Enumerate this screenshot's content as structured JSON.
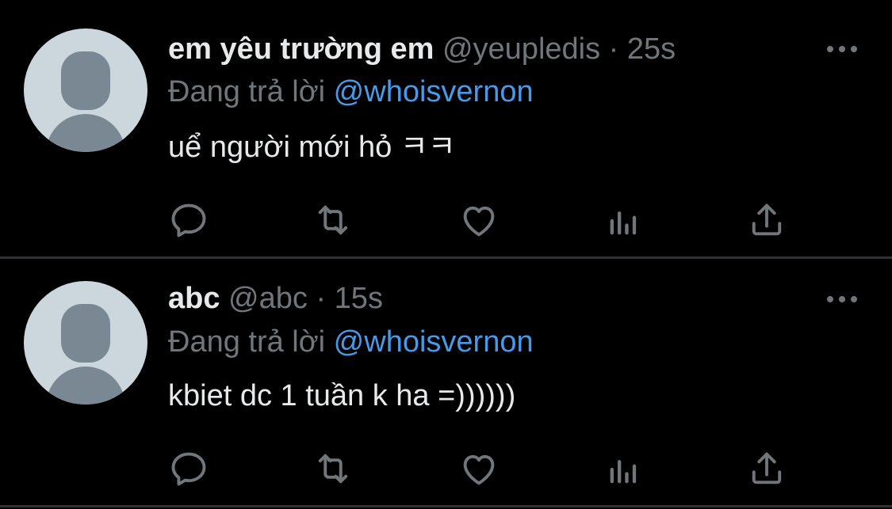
{
  "tweets": [
    {
      "name": "em yêu trường em",
      "handle": "@yeupledis",
      "separator": "·",
      "time": "25s",
      "reply_prefix": "Đang trả lời",
      "reply_to": "@whoisvernon",
      "text": "uể người mới hỏ ㅋㅋ"
    },
    {
      "name": "abc",
      "handle": "@abc",
      "separator": "·",
      "time": "15s",
      "reply_prefix": "Đang trả lời",
      "reply_to": "@whoisvernon",
      "text": "kbiet dc 1 tuần k ha =))))))"
    }
  ],
  "icons": [
    "avatar-placeholder",
    "more-icon",
    "reply-icon",
    "retweet-icon",
    "like-icon",
    "views-icon",
    "share-icon"
  ],
  "colors": {
    "background": "#000000",
    "text": "#e7e9ea",
    "muted": "#71767b",
    "link": "#4a99e9",
    "divider": "#2f3336"
  }
}
